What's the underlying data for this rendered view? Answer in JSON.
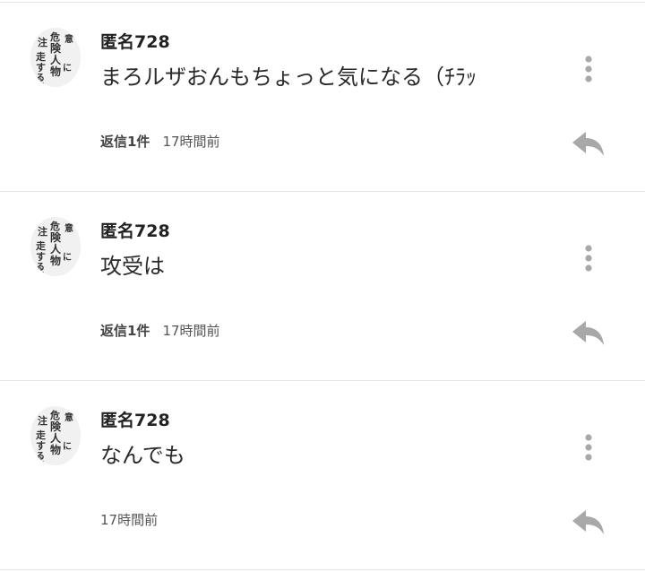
{
  "comments": [
    {
      "author": "匿名728",
      "text": "まろルザおんもちょっと気になる（ﾁﾗｯ",
      "reply_count": "返信1件",
      "time": "17時間前"
    },
    {
      "author": "匿名728",
      "text": "攻受は",
      "reply_count": "返信1件",
      "time": "17時間前"
    },
    {
      "author": "匿名728",
      "text": "なんでも",
      "reply_count": "",
      "time": "17時間前"
    }
  ],
  "icons": {
    "more": "more-vertical-icon",
    "reply": "reply-arrow-icon"
  },
  "avatar_lettering": [
    "危",
    "険",
    "人",
    "物",
    "に",
    "注",
    "意",
    "走",
    "す",
    "る",
    "!!!"
  ],
  "colors": {
    "icon_gray": "#a8a8a8",
    "divider": "#e6e6e6"
  }
}
